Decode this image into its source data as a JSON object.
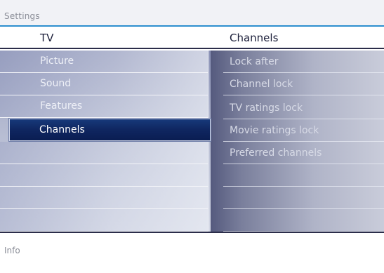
{
  "breadcrumb": "Settings",
  "header": {
    "left_title": "TV",
    "right_title": "Channels"
  },
  "menu": {
    "items": [
      {
        "label": "Picture"
      },
      {
        "label": "Sound"
      },
      {
        "label": "Features"
      },
      {
        "label": "Channels",
        "selected": true
      },
      {
        "label": ""
      },
      {
        "label": ""
      },
      {
        "label": ""
      },
      {
        "label": ""
      }
    ]
  },
  "submenu": {
    "items": [
      {
        "label": "Lock after"
      },
      {
        "label": "Channel lock"
      },
      {
        "label": "TV ratings lock"
      },
      {
        "label": "Movie ratings lock"
      },
      {
        "label": "Preferred channels"
      },
      {
        "label": ""
      },
      {
        "label": ""
      },
      {
        "label": ""
      }
    ]
  },
  "footer": {
    "info": "Info"
  },
  "colors": {
    "accent_line": "#2d8fcf",
    "selected_bg": "#0f2660",
    "divider": "#2b2d4a"
  }
}
